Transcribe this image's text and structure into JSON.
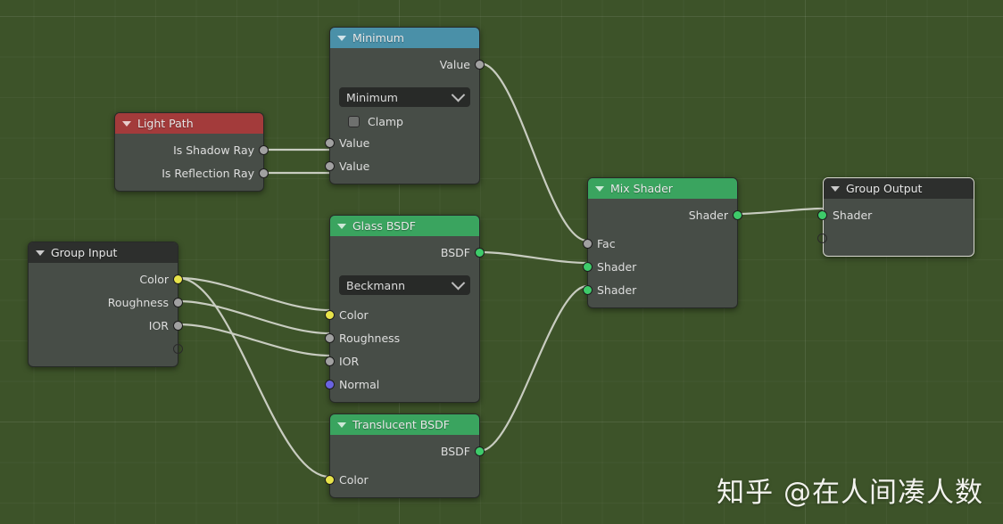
{
  "editor": {
    "background_color": "#3d5329",
    "node_body_color": "#474d47",
    "link_color": "#c8ccc0"
  },
  "watermark": {
    "text": "知乎 @在人间凑人数"
  },
  "nodes": [
    {
      "id": "light-path",
      "title": "Light Path",
      "header_color": "#a33b3b",
      "outputs": [
        {
          "label": "Is Shadow Ray",
          "socket": "gray"
        },
        {
          "label": "Is Reflection Ray",
          "socket": "gray"
        }
      ],
      "inputs": []
    },
    {
      "id": "minimum",
      "title": "Minimum",
      "header_color": "#4a90a8",
      "outputs": [
        {
          "label": "Value",
          "socket": "gray"
        }
      ],
      "dropdown": {
        "value": "Minimum",
        "icon": "chevron-down-icon"
      },
      "checkbox": {
        "label": "Clamp",
        "checked": false
      },
      "inputs": [
        {
          "label": "Value",
          "socket": "gray"
        },
        {
          "label": "Value",
          "socket": "gray"
        }
      ]
    },
    {
      "id": "glass-bsdf",
      "title": "Glass BSDF",
      "header_color": "#3aa45f",
      "outputs": [
        {
          "label": "BSDF",
          "socket": "green"
        }
      ],
      "dropdown": {
        "value": "Beckmann",
        "icon": "chevron-down-icon"
      },
      "inputs": [
        {
          "label": "Color",
          "socket": "yellow"
        },
        {
          "label": "Roughness",
          "socket": "gray"
        },
        {
          "label": "IOR",
          "socket": "gray"
        },
        {
          "label": "Normal",
          "socket": "purple"
        }
      ]
    },
    {
      "id": "translucent-bsdf",
      "title": "Translucent BSDF",
      "header_color": "#3aa45f",
      "outputs": [
        {
          "label": "BSDF",
          "socket": "green"
        }
      ],
      "inputs": [
        {
          "label": "Color",
          "socket": "yellow"
        }
      ]
    },
    {
      "id": "group-input",
      "title": "Group Input",
      "header_color": "#2d2f2d",
      "outputs": [
        {
          "label": "Color",
          "socket": "yellow"
        },
        {
          "label": "Roughness",
          "socket": "gray"
        },
        {
          "label": "IOR",
          "socket": "gray"
        },
        {
          "label": "",
          "socket": "empty"
        }
      ],
      "inputs": []
    },
    {
      "id": "mix-shader",
      "title": "Mix Shader",
      "header_color": "#3aa45f",
      "outputs": [
        {
          "label": "Shader",
          "socket": "green"
        }
      ],
      "inputs": [
        {
          "label": "Fac",
          "socket": "gray"
        },
        {
          "label": "Shader",
          "socket": "green"
        },
        {
          "label": "Shader",
          "socket": "green"
        }
      ]
    },
    {
      "id": "group-output",
      "title": "Group Output",
      "header_color": "#2d2f2d",
      "active": true,
      "outputs": [],
      "inputs": [
        {
          "label": "Shader",
          "socket": "green"
        },
        {
          "label": "",
          "socket": "empty"
        }
      ]
    }
  ],
  "links": [
    {
      "from": "light-path.Is Shadow Ray",
      "to": "minimum.Value-1"
    },
    {
      "from": "light-path.Is Reflection Ray",
      "to": "minimum.Value-2"
    },
    {
      "from": "minimum.Value",
      "to": "mix-shader.Fac"
    },
    {
      "from": "glass-bsdf.BSDF",
      "to": "mix-shader.Shader-1"
    },
    {
      "from": "translucent-bsdf.BSDF",
      "to": "mix-shader.Shader-2"
    },
    {
      "from": "group-input.Color",
      "to": "glass-bsdf.Color"
    },
    {
      "from": "group-input.Color",
      "to": "translucent-bsdf.Color"
    },
    {
      "from": "group-input.Roughness",
      "to": "glass-bsdf.Roughness"
    },
    {
      "from": "group-input.IOR",
      "to": "glass-bsdf.IOR"
    },
    {
      "from": "mix-shader.Shader",
      "to": "group-output.Shader"
    }
  ]
}
